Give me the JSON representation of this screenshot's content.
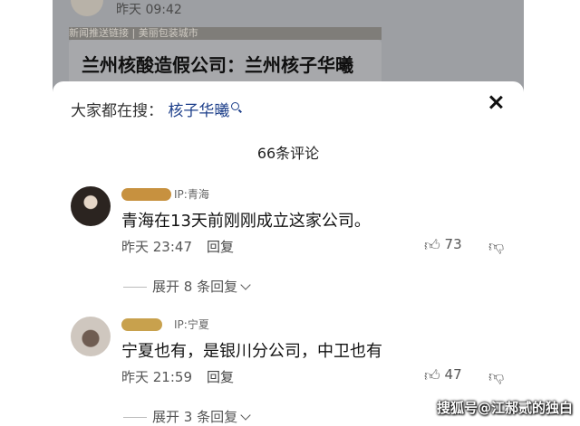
{
  "background": {
    "time": "昨天 09:42",
    "strip_text": "新闻推送链接 | 美丽包装城市",
    "card_title": "兰州核酸造假公司：兰州核子华曦"
  },
  "sheet": {
    "search_prefix": "大家都在搜：",
    "search_term": "核子华曦",
    "comment_count": "66条评论"
  },
  "comments": [
    {
      "ip": "IP:青海",
      "text": "青海在13天前刚刚成立这家公司。",
      "time": "昨天 23:47",
      "reply_label": "回复",
      "likes": "73",
      "expand_label": "展开 8 条回复"
    },
    {
      "ip": "IP:宁夏",
      "text": "宁夏也有，是银川分公司，中卫也有",
      "time": "昨天 21:59",
      "reply_label": "回复",
      "likes": "47",
      "expand_label": "展开 3 条回复"
    }
  ],
  "watermark": "搜狐号@江郝贰的独白",
  "icons": {
    "search": "search-icon",
    "close": "close-icon",
    "like": "thumb-up-icon",
    "dislike": "thumb-down-icon",
    "expand": "chevron-down-icon"
  }
}
